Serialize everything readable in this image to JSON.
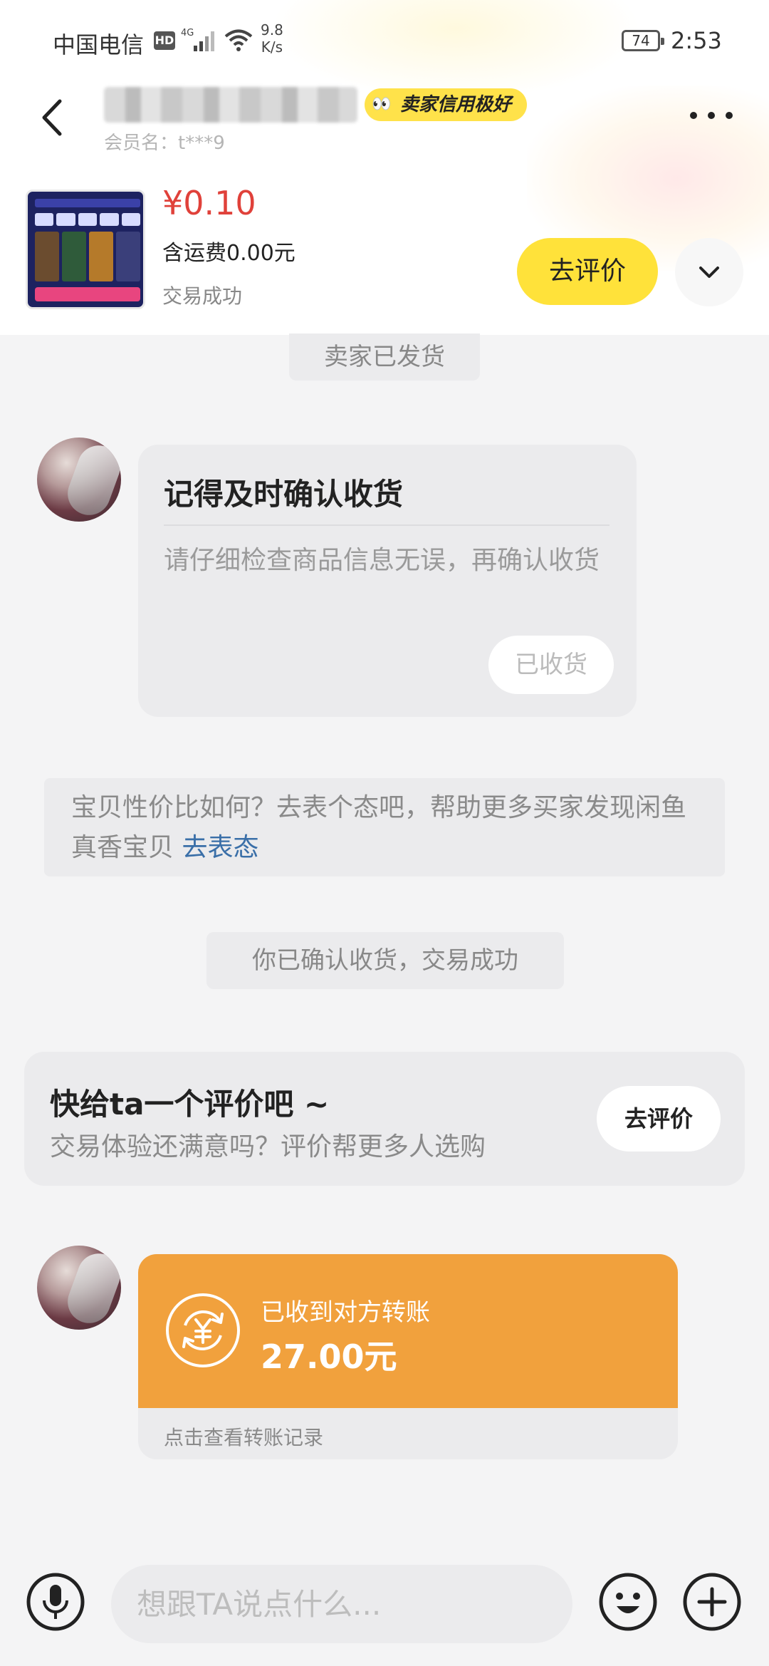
{
  "statusbar": {
    "carrier": "中国电信",
    "hd": "HD",
    "network": "4G",
    "speed_value": "9.8",
    "speed_unit": "K/s",
    "battery": "74",
    "time": "2:53"
  },
  "header": {
    "credit_badge": "卖家信用极好",
    "member": "会员名：t***9"
  },
  "product": {
    "price": "¥0.10",
    "shipping": "含运费0.00元",
    "status": "交易成功",
    "review_button": "去评价"
  },
  "chat": {
    "shipped_notice": "卖家已发货",
    "confirm_card": {
      "title": "记得及时确认收货",
      "description": "请仔细检查商品信息无误，再确认收货",
      "button": "已收货"
    },
    "attitude": {
      "text": "宝贝性价比如何？去表个态吧，帮助更多买家发现闲鱼真香宝贝",
      "link": "去表态"
    },
    "confirmed_notice": "你已确认收货，交易成功",
    "review_card": {
      "title": "快给ta一个评价吧 ~",
      "subtitle": "交易体验还满意吗？评价帮更多人选购",
      "button": "去评价"
    },
    "transfer_card": {
      "label": "已收到对方转账",
      "amount": "27.00元",
      "link": "点击查看转账记录"
    }
  },
  "input": {
    "placeholder": "想跟TA说点什么..."
  },
  "colors": {
    "accent_yellow": "#ffe23a",
    "price_red": "#e0413a",
    "transfer_orange": "#f1a13d",
    "link_blue": "#3a6fa8"
  }
}
